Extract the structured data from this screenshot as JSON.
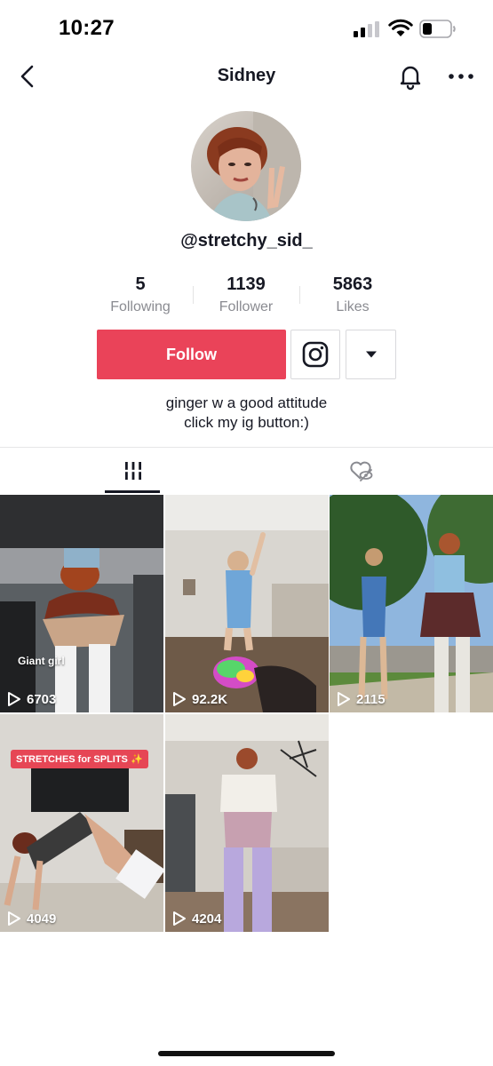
{
  "status_bar": {
    "time": "10:27",
    "icons": [
      "cellular-signal-icon",
      "wifi-icon",
      "battery-icon"
    ]
  },
  "nav": {
    "title": "Sidney",
    "icons": [
      "back-chevron-icon",
      "bell-icon",
      "more-dots-icon"
    ]
  },
  "profile": {
    "username": "@stretchy_sid_",
    "avatar": "profile-photo",
    "stats": [
      {
        "value": "5",
        "label": "Following"
      },
      {
        "value": "1139",
        "label": "Follower"
      },
      {
        "value": "5863",
        "label": "Likes"
      }
    ],
    "follow_label": "Follow",
    "instagram_icon": "instagram-icon",
    "dropdown_icon": "caret-down-icon",
    "bio_lines": [
      "ginger w a good attitude",
      "click my ig button:)"
    ]
  },
  "tabs": [
    {
      "name": "videos",
      "icon": "grid-bars-icon",
      "active": true
    },
    {
      "name": "liked",
      "icon": "liked-hidden-heart-icon",
      "active": false
    }
  ],
  "videos": [
    {
      "views": "6703",
      "overlay": "Giant girl"
    },
    {
      "views": "92.2K"
    },
    {
      "views": "2115"
    },
    {
      "views": "4049",
      "caption": "STRETCHES for SPLITS ✨"
    },
    {
      "views": "4204"
    }
  ],
  "colors": {
    "accent": "#ea4359",
    "text": "#161823",
    "muted": "#8a8b91",
    "divider": "#e6e6e7"
  }
}
